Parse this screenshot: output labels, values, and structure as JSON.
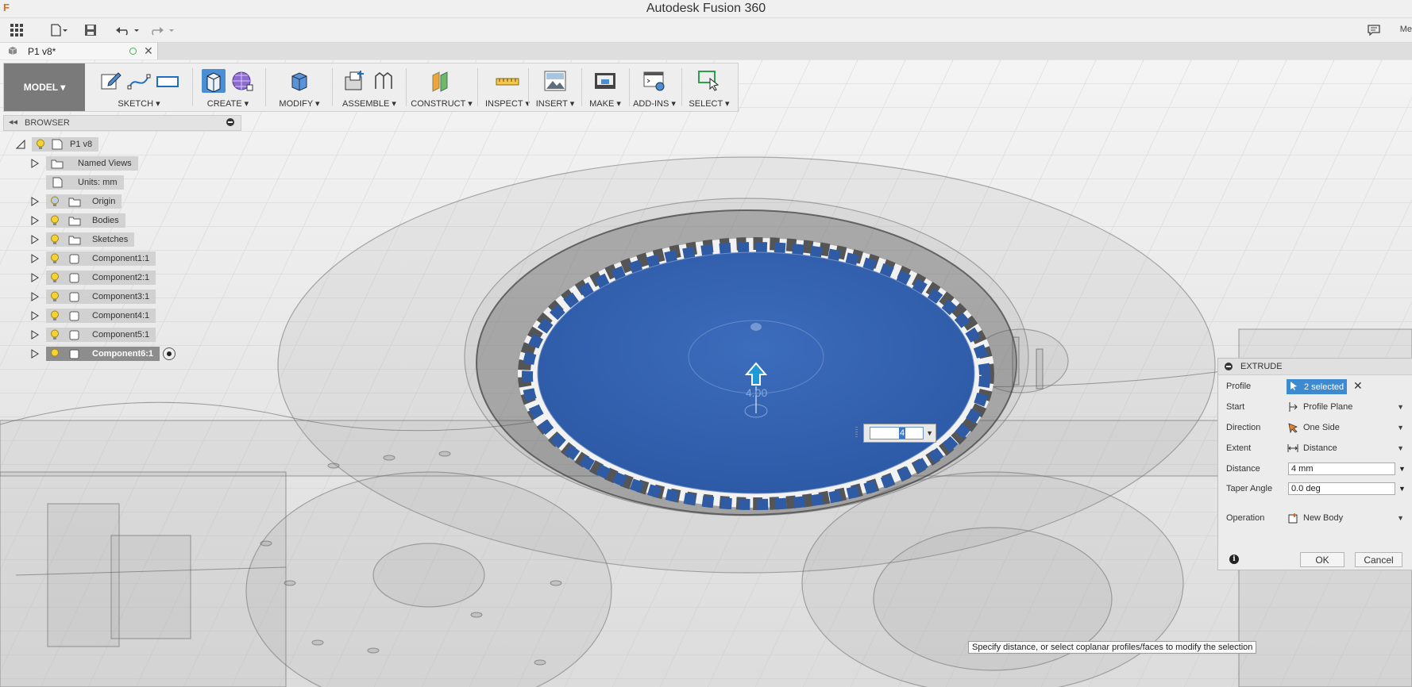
{
  "app": {
    "title": "Autodesk Fusion 360",
    "logo": "F",
    "user": "Me"
  },
  "document": {
    "tab_label": "P1 v8*"
  },
  "toolbar": {
    "mode": "MODEL ▾",
    "groups": {
      "sketch": "SKETCH ▾",
      "create": "CREATE ▾",
      "modify": "MODIFY ▾",
      "assemble": "ASSEMBLE ▾",
      "construct": "CONSTRUCT ▾",
      "inspect": "INSPECT ▾",
      "insert": "INSERT ▾",
      "make": "MAKE ▾",
      "addins": "ADD-INS ▾",
      "select": "SELECT ▾"
    }
  },
  "browser": {
    "title": "BROWSER",
    "root": "P1 v8",
    "items": [
      {
        "label": "Named Views",
        "icon": "folder-icon"
      },
      {
        "label": "Units: mm",
        "icon": "document-icon"
      },
      {
        "label": "Origin",
        "icon": "folder-icon"
      },
      {
        "label": "Bodies",
        "icon": "folder-icon"
      },
      {
        "label": "Sketches",
        "icon": "folder-icon"
      },
      {
        "label": "Component1:1",
        "icon": "component-icon"
      },
      {
        "label": "Component2:1",
        "icon": "component-icon"
      },
      {
        "label": "Component3:1",
        "icon": "component-icon"
      },
      {
        "label": "Component4:1",
        "icon": "component-icon"
      },
      {
        "label": "Component5:1",
        "icon": "component-icon"
      },
      {
        "label": "Component6:1",
        "icon": "component-icon",
        "selected": true
      }
    ]
  },
  "extrude": {
    "title": "EXTRUDE",
    "profile": {
      "label": "Profile",
      "value": "2 selected"
    },
    "start": {
      "label": "Start",
      "value": "Profile Plane"
    },
    "direction": {
      "label": "Direction",
      "value": "One Side"
    },
    "extent": {
      "label": "Extent",
      "value": "Distance"
    },
    "distance": {
      "label": "Distance",
      "value": "4 mm"
    },
    "taper": {
      "label": "Taper Angle",
      "value": "0.0 deg"
    },
    "operation": {
      "label": "Operation",
      "value": "New Body"
    },
    "ok": "OK",
    "cancel": "Cancel"
  },
  "viewport": {
    "distance_input": "4",
    "dimension_label": "4.00",
    "hint": "Specify distance, or select coplanar profiles/faces to modify the selection"
  },
  "colors": {
    "accent": "#3d8ad1",
    "selection_blue": "#3563b0",
    "mode_bg": "#7a7a7a"
  }
}
